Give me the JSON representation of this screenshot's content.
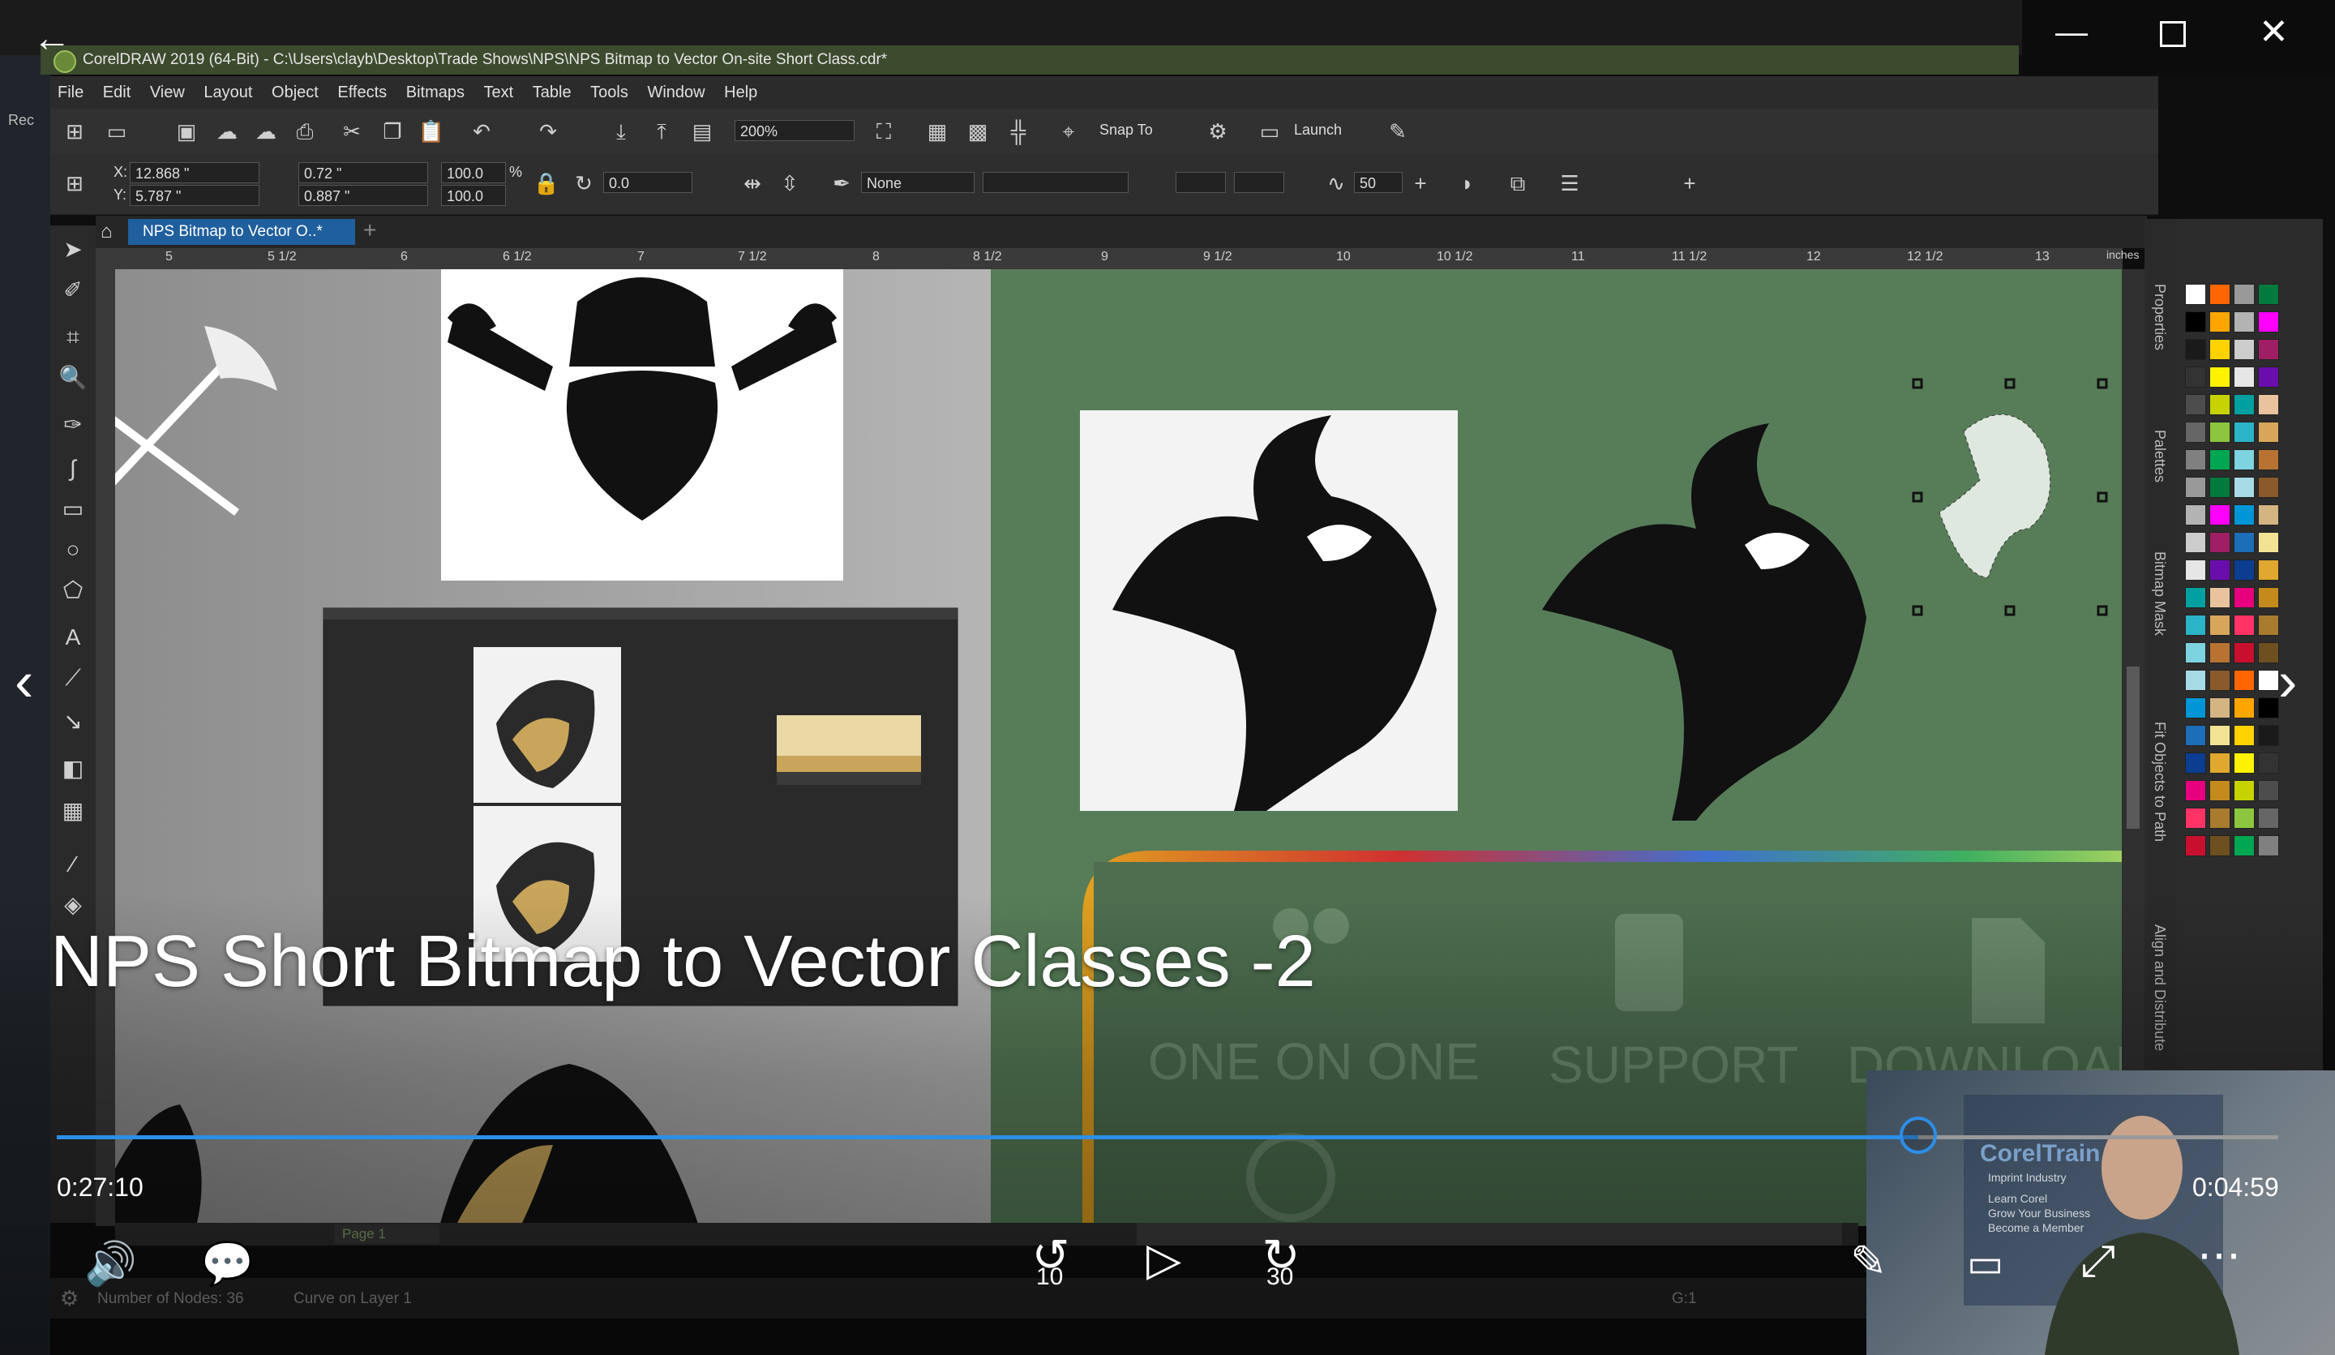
{
  "corel": {
    "title": "CorelDRAW 2019 (64-Bit) - C:\\Users\\clayb\\Desktop\\Trade Shows\\NPS\\NPS Bitmap to Vector On-site Short Class.cdr*",
    "menu": [
      "File",
      "Edit",
      "View",
      "Layout",
      "Object",
      "Effects",
      "Bitmaps",
      "Text",
      "Table",
      "Tools",
      "Window",
      "Help"
    ],
    "toolbar": {
      "zoom": "200%",
      "snap_to": "Snap To",
      "launch": "Launch"
    },
    "propbar": {
      "x": "12.868 \"",
      "y": "5.787 \"",
      "w": "0.72 \"",
      "h": "0.887 \"",
      "scale_w": "100.0",
      "scale_h": "100.0",
      "pct": "%",
      "rotation": "0.0",
      "outline": "None",
      "smoothing": "50",
      "x_label": "X:",
      "y_label": "Y:"
    },
    "doc_tab": "NPS Bitmap to Vector O..*",
    "ruler_unit": "inches",
    "ruler_ticks": [
      "5",
      "5 1/2",
      "6",
      "6 1/2",
      "7",
      "7 1/2",
      "8",
      "8 1/2",
      "9",
      "9 1/2",
      "10",
      "10 1/2",
      "11",
      "11 1/2",
      "12",
      "12 1/2",
      "13"
    ],
    "dockers": [
      "Properties",
      "Palettes",
      "Bitmap Mask",
      "Fit Objects to Path",
      "Align and Distribute"
    ],
    "status": {
      "nodes": "Number of Nodes: 36",
      "layer": "Curve on Layer 1",
      "page": "Page 1",
      "fill": "G:1"
    },
    "canvas_text": {
      "one_on_one": "ONE ON ONE",
      "support": "SUPPORT",
      "download": "DOWNLOAD"
    },
    "palette_colors": [
      "#ffffff",
      "#000000",
      "#1a1a1a",
      "#333333",
      "#4d4d4d",
      "#666666",
      "#808080",
      "#999999",
      "#b3b3b3",
      "#cccccc",
      "#e6e6e6",
      "#00a0a0",
      "#2bb3c7",
      "#7ed3e0",
      "#a6dbe6",
      "#0096d6",
      "#1c6eb8",
      "#0b3d91",
      "#e6007e",
      "#ff3366",
      "#c8102e",
      "#ff6600",
      "#ffa500",
      "#ffd200",
      "#fff200",
      "#c6d300",
      "#8cc63f",
      "#00a651",
      "#007a3d",
      "#ff00ff",
      "#9e1f63",
      "#6a0dad",
      "#e8c39e",
      "#d8a65a",
      "#b87333",
      "#8b5a2b",
      "#d4b483",
      "#f2e394",
      "#e0a82e",
      "#c48a1c",
      "#a97b2e",
      "#6e4f1f"
    ]
  },
  "player": {
    "title": "NPS Short Bitmap to Vector Classes -2",
    "elapsed": "0:27:10",
    "remaining": "0:04:59",
    "progress": 0.838,
    "skip_back": "10",
    "skip_fwd": "30"
  },
  "thumbnail": {
    "brand": "CorelTrain",
    "sub1": "Imprint Industry",
    "sub2": "Learn Corel",
    "sub3": "Grow Your Business",
    "sub4": "Become a Member"
  },
  "host": {
    "side_label": "Rec"
  }
}
